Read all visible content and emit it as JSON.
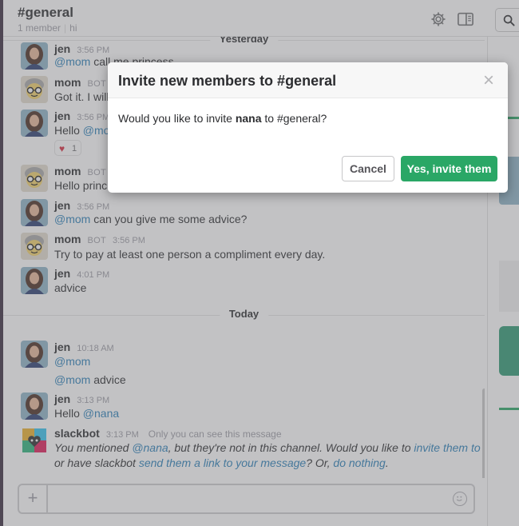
{
  "header": {
    "channel_name": "#general",
    "member_count": "1 member",
    "topic": "hi"
  },
  "dividers": {
    "yesterday": "Yesterday",
    "today": "Today"
  },
  "messages": [
    {
      "author": "jen",
      "time": "3:56 PM",
      "mention": "@mom",
      "text": " call me princess"
    },
    {
      "author": "mom",
      "bot_tag": "BOT",
      "time": "3:56 PM",
      "text": "Got it. I will"
    },
    {
      "author": "jen",
      "time": "3:56 PM",
      "mention": "@mom",
      "text": "",
      "prefix": "Hello ",
      "reaction_count": "1"
    },
    {
      "author": "mom",
      "bot_tag": "BOT",
      "time": "3:56 PM",
      "text": "Hello princ"
    },
    {
      "author": "jen",
      "time": "3:56 PM",
      "mention": "@mom",
      "text": " can you give me some advice?"
    },
    {
      "author": "mom",
      "bot_tag": "BOT",
      "time": "3:56 PM",
      "text": "Try to pay at least one person a compliment every day."
    },
    {
      "author": "jen",
      "time": "4:01 PM",
      "text": "advice"
    },
    {
      "author": "jen",
      "time": "10:18 AM",
      "mention": "@mom",
      "text": "",
      "mention2": "@mom",
      "text2": " advice"
    },
    {
      "author": "jen",
      "time": "3:13 PM",
      "prefix": "Hello ",
      "mention": "@nana"
    },
    {
      "author": "slackbot",
      "time": "3:13 PM",
      "only_you": "Only you can see this message",
      "line1_a": "You mentioned ",
      "line1_mention": "@nana",
      "line1_b": ", but they're not in this channel. Would you like to ",
      "line1_link": "invite them to join",
      "line2_a": "or have slackbot ",
      "line2_link": "send them a link to your message",
      "line2_b": "? Or, ",
      "line2_link2": "do nothing",
      "line2_c": "."
    }
  ],
  "composer": {
    "plus_label": "+"
  },
  "modal": {
    "title": "Invite new members to #general",
    "close_label": "×",
    "text_a": "Would you like to invite ",
    "text_user": "nana",
    "text_b": " to #general?",
    "cancel_label": "Cancel",
    "confirm_label": "Yes, invite them"
  },
  "colors": {
    "accent_green": "#2aa766",
    "mention_blue": "#2a80b9",
    "sidebar_dark": "#3a2b3e"
  }
}
